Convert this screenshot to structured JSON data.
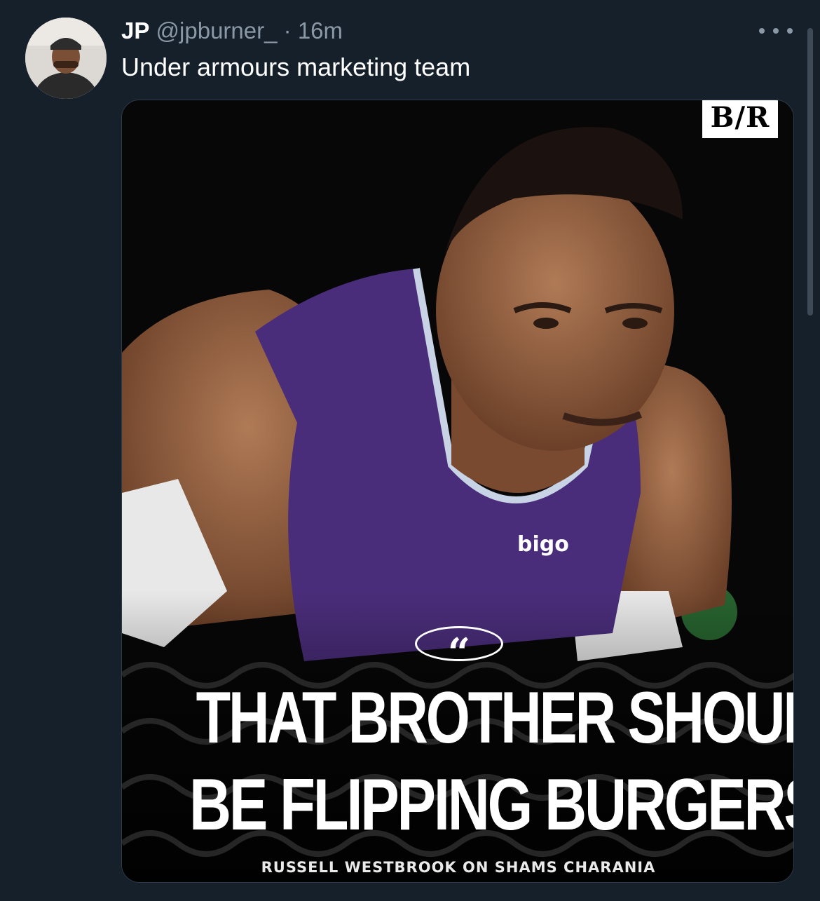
{
  "author": {
    "name": "JP",
    "handle": "@jpburner_",
    "separator": "·",
    "time": "16m"
  },
  "tweet": {
    "text": "Under armours marketing team"
  },
  "media": {
    "logo": "B/R",
    "quote_icon": "quote-icon",
    "jersey_text": "bigo",
    "headline_line1": "THAT BROTHER SHOULD",
    "headline_line2": "BE FLIPPING BURGERS.",
    "attribution": "RUSSELL WESTBROOK ON SHAMS CHARANIA"
  },
  "icons": {
    "more": "more-options-icon",
    "avatar": "avatar"
  },
  "colors": {
    "background": "#15202b",
    "secondary_text": "#8b98a5",
    "primary_text": "#ffffff",
    "jersey_purple": "#4a2d7a"
  }
}
